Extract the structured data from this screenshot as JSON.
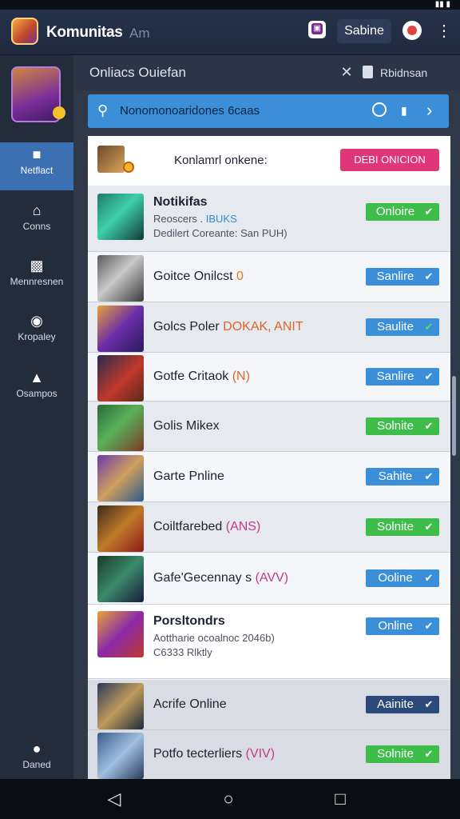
{
  "header": {
    "title": "Komunitas",
    "subtitle": "Am",
    "inbox_icon": "inbox-icon",
    "search_chip": "Sabine",
    "more": "⋮"
  },
  "sidebar": {
    "items": [
      {
        "label": "Netflact",
        "icon": "bag-icon",
        "active": true
      },
      {
        "label": "Conns",
        "icon": "home-icon",
        "active": false
      },
      {
        "label": "Mennresnen",
        "icon": "clipboard-icon",
        "active": false
      },
      {
        "label": "Kropaley",
        "icon": "camera-icon",
        "active": false
      },
      {
        "label": "Osampos",
        "icon": "cap-icon",
        "active": false
      }
    ],
    "bottom_item": {
      "label": "Daned",
      "icon": "chat-icon"
    }
  },
  "panel": {
    "title": "Onliacs Ouiefan",
    "chip_label": "Rbidnsan"
  },
  "search": {
    "text": "Nonomonoaridones 6caas"
  },
  "promo": {
    "text": "Konlamrl onkene:",
    "button": "DEBI ONICION"
  },
  "rows": [
    {
      "name": "Notikifas",
      "bold": true,
      "tag": "",
      "sub1": "Reoscers .",
      "sub1_tag": "IBUKS",
      "sub2": "Dedilert Coreante: San PUH)",
      "status": "Onloire",
      "variant": "green"
    },
    {
      "name": "Goitce Onilcst",
      "tag": "0",
      "status": "Sanlire",
      "variant": "blue"
    },
    {
      "name": "Golcs Poler",
      "tag": "DOKAK, ANIT",
      "status": "Saulite",
      "variant": "blue"
    },
    {
      "name": "Gotfe Critaok",
      "tag": "(N)",
      "status": "Sanlire",
      "variant": "blue"
    },
    {
      "name": "Golis Mikex",
      "tag": "",
      "status": "Solnite",
      "variant": "green"
    },
    {
      "name": "Garte Pnline",
      "tag": "",
      "status": "Sahite",
      "variant": "blue"
    },
    {
      "name": "Coiltfarebed",
      "tag": "(ANS)",
      "status": "Solnite",
      "variant": "green"
    },
    {
      "name": "Gafe'Gecennay s",
      "tag": "(AVV)",
      "status": "Ooline",
      "variant": "blue"
    },
    {
      "name": "Porsltondrs",
      "bold": true,
      "tag": "",
      "sub1": "Aottharie ocoalnoc 2046b)",
      "sub1_tag": "",
      "sub2": "C6333 Rlktly",
      "status": "Online",
      "variant": "blue"
    },
    {
      "name": "Acrife Online",
      "tag": "",
      "status": "Aainite",
      "variant": "navy"
    },
    {
      "name": "Potfo tecterliers",
      "tag": "(VIV)",
      "status": "Solnite",
      "variant": "green"
    }
  ],
  "colors": {
    "accent_blue": "#3a8fd8",
    "status_green": "#3fbd4a",
    "promo_pink": "#e0357a",
    "sidebar_bg": "#222c3b"
  },
  "navbar": {
    "back": "◁",
    "home": "○",
    "recents": "□"
  }
}
